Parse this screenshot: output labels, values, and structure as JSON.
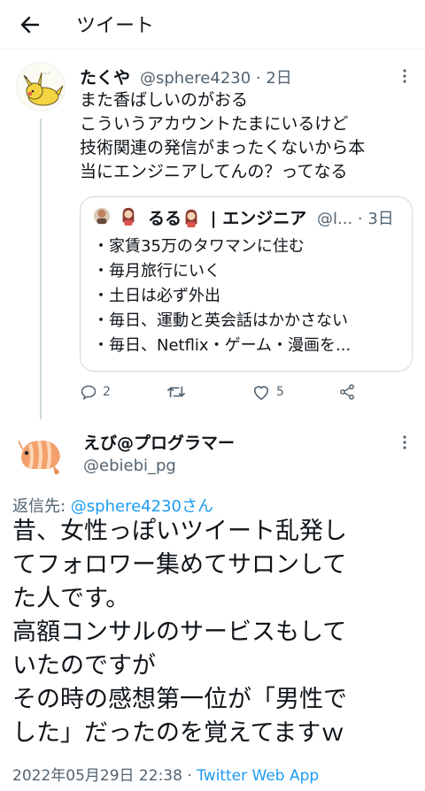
{
  "header": {
    "title": "ツイート"
  },
  "tweet1": {
    "name": "たくや",
    "handle": "@sphere4230 · 2日",
    "lines": [
      "また香ばしいのがおる",
      "こういうアカウントたまにいるけど",
      "技術関連の発信がまったくないから本",
      "当にエンジニアしてんの？ってなる"
    ],
    "quote": {
      "name": "るる",
      "title": "| エンジニア",
      "handle": "@l... · 3日",
      "lines": [
        "・家賃35万のタワマンに住む",
        "・毎月旅行にいく",
        "・土日は必ず外出",
        "・毎日、運動と英会話はかかさない",
        "・毎日、Netflix・ゲーム・漫画を..."
      ]
    },
    "actions": {
      "reply_count": "2",
      "retweet_count": "",
      "like_count": "5"
    }
  },
  "tweet2": {
    "name": "えび@プログラマー",
    "handle": "@ebiebi_pg",
    "reply_prefix": "返信先: ",
    "reply_target": "@sphere4230さん",
    "lines": [
      "昔、女性っぽいツイート乱発し",
      "てフォロワー集めてサロンして",
      "た人です。",
      "高額コンサルのサービスもして",
      "いたのですが",
      "その時の感想第一位が「男性で",
      "した」だったのを覚えてますｗ"
    ],
    "timestamp": "2022年05月29日 22:38",
    "separator": " · ",
    "source": "Twitter Web App"
  },
  "colors": {
    "accent": "#1d9bf0",
    "secondary": "#536471",
    "text": "#0f1419",
    "border": "#cfd9de"
  }
}
